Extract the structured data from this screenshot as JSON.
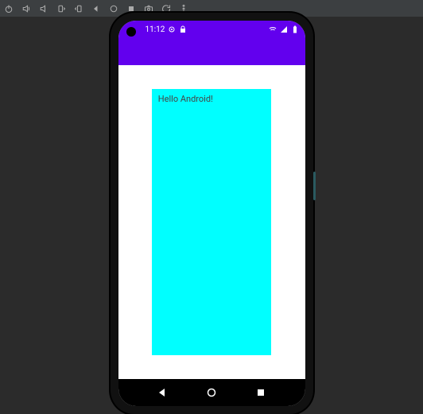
{
  "toolbar": {
    "icons": [
      "power",
      "volume-up",
      "volume-down",
      "rotate-left",
      "rotate-right",
      "back",
      "home",
      "overview",
      "screenshot",
      "reload",
      "more"
    ]
  },
  "status_bar": {
    "time": "11:12",
    "left_icons": [
      "settings-dot",
      "lock"
    ],
    "right_icons": [
      "wifi",
      "signal",
      "battery"
    ]
  },
  "app": {
    "greeting": "Hello Android!"
  },
  "nav": {
    "buttons": [
      "back",
      "home",
      "recent"
    ]
  }
}
